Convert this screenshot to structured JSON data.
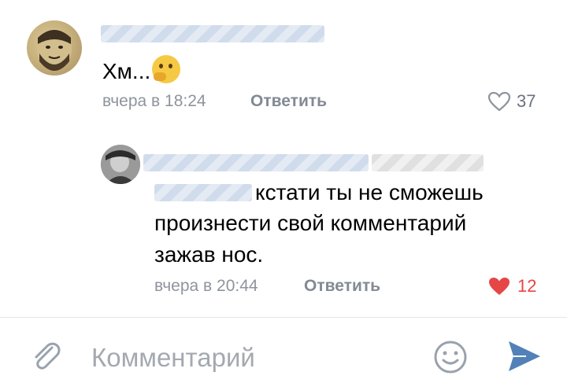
{
  "comments": [
    {
      "text": "Хм...",
      "emoji": "thinking-face",
      "time": "вчера в 18:24",
      "reply_label": "Ответить",
      "likes": "37",
      "liked": false
    },
    {
      "text_line1": "кстати ты не сможешь",
      "text_line2": "произнести свой комментарий",
      "text_line3": "зажав нос.",
      "time": "вчера в 20:44",
      "reply_label": "Ответить",
      "likes": "12",
      "liked": true
    }
  ],
  "composer": {
    "placeholder": "Комментарий",
    "attach_icon": "paperclip-icon",
    "emoji_icon": "smiley-icon",
    "send_icon": "send-arrow-icon"
  },
  "colors": {
    "like_active": "#e64646",
    "send": "#5181b8",
    "muted": "#8e949c"
  }
}
